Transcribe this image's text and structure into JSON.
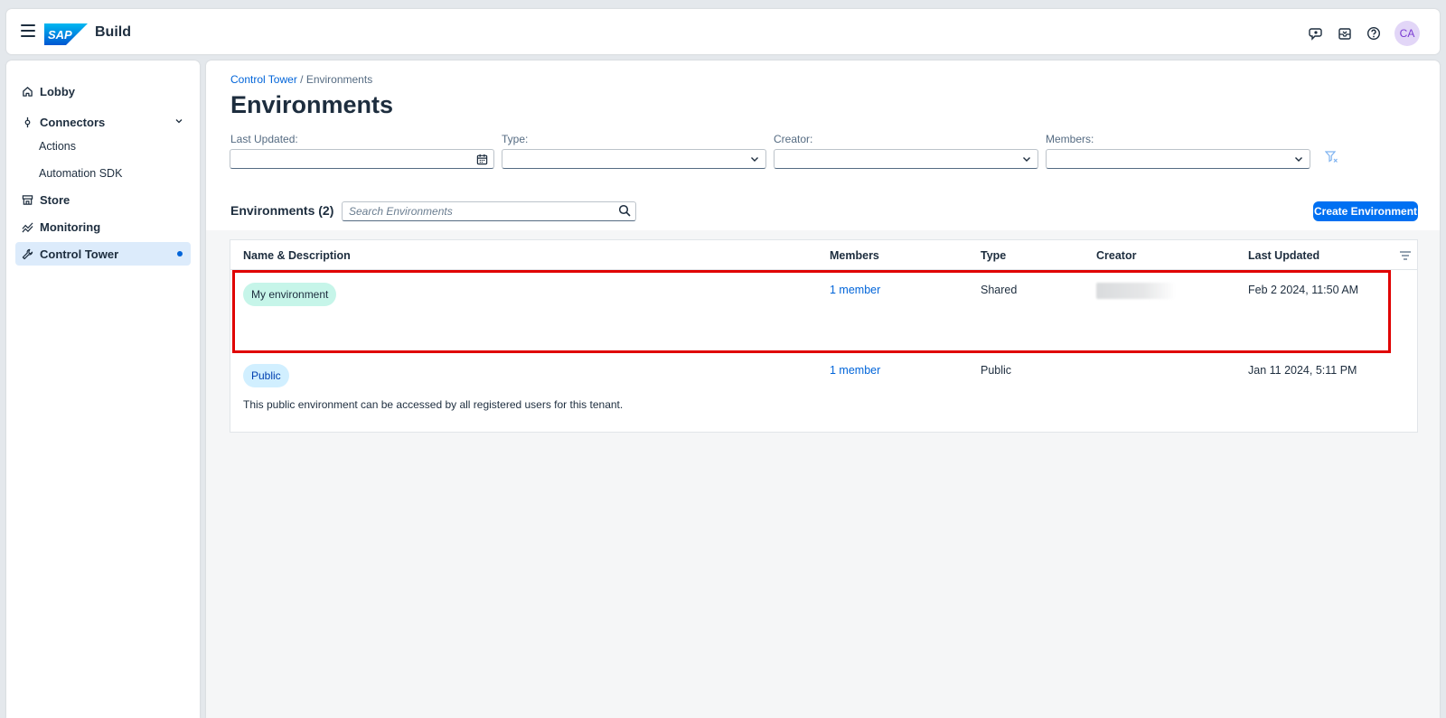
{
  "header": {
    "product": "Build",
    "logo_text": "SAP",
    "avatar_initials": "CA",
    "icons": [
      "copilot-icon",
      "inbox-icon",
      "help-icon"
    ]
  },
  "sidebar": {
    "items": [
      {
        "label": "Lobby",
        "icon": "home-icon"
      },
      {
        "label": "Connectors",
        "icon": "connector-icon"
      },
      {
        "label": "Actions"
      },
      {
        "label": "Automation SDK"
      },
      {
        "label": "Store",
        "icon": "store-icon"
      },
      {
        "label": "Monitoring",
        "icon": "monitoring-icon"
      },
      {
        "label": "Control Tower",
        "icon": "wrench-icon",
        "active": true
      }
    ]
  },
  "breadcrumb": {
    "parent": "Control Tower",
    "separator": " / ",
    "current": "Environments"
  },
  "page": {
    "title": "Environments"
  },
  "filters": {
    "last_updated": {
      "label": "Last Updated:",
      "value": ""
    },
    "type": {
      "label": "Type:",
      "value": ""
    },
    "creator": {
      "label": "Creator:",
      "value": ""
    },
    "members": {
      "label": "Members:",
      "value": ""
    }
  },
  "toolbar": {
    "count_label": "Environments (2)",
    "search_placeholder": "Search Environments",
    "create_label": "Create Environment"
  },
  "table": {
    "columns": [
      "Name & Description",
      "Members",
      "Type",
      "Creator",
      "Last Updated"
    ],
    "rows": [
      {
        "name": "My environment",
        "members": "1 member",
        "type": "Shared",
        "creator": "",
        "last_updated": "Feb 2 2024, 11:50 AM",
        "description": ""
      },
      {
        "name": "Public",
        "members": "1 member",
        "type": "Public",
        "creator": "",
        "last_updated": "Jan 11 2024, 5:11 PM",
        "description": "This public environment can be accessed by all registered users for this tenant."
      }
    ]
  },
  "colors": {
    "accent": "#0070f2",
    "link": "#0064d9",
    "highlight": "#e00000",
    "tag_green": "#c6f5e9",
    "tag_blue": "#d1efff"
  }
}
